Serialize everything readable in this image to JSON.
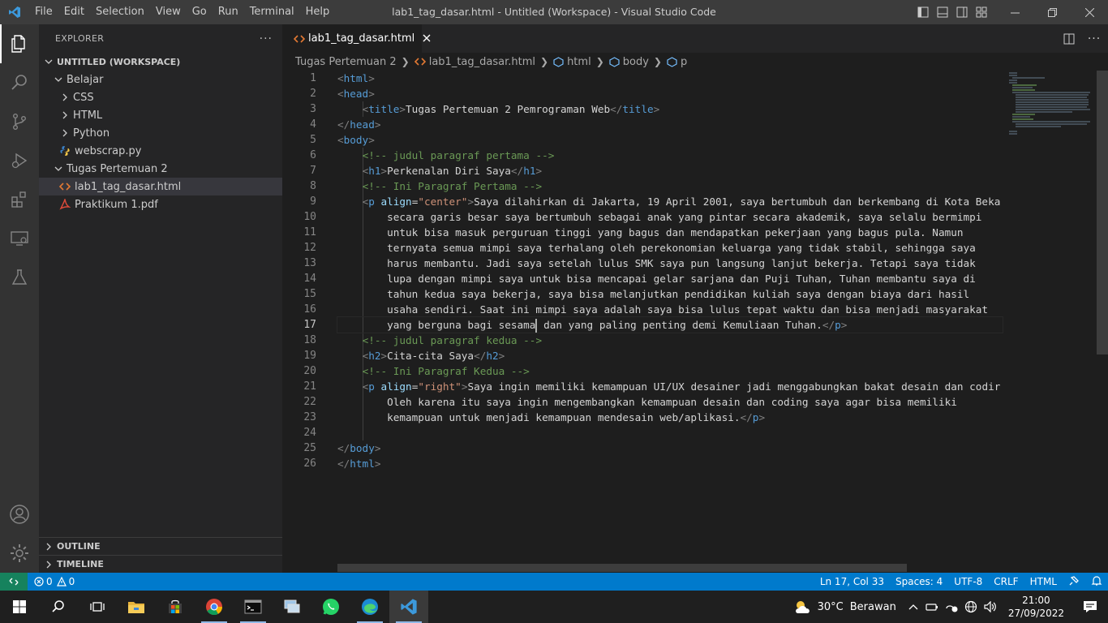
{
  "window": {
    "title": "lab1_tag_dasar.html - Untitled (Workspace) - Visual Studio Code",
    "menu": [
      "File",
      "Edit",
      "Selection",
      "View",
      "Go",
      "Run",
      "Terminal",
      "Help"
    ]
  },
  "sidebar": {
    "header": "EXPLORER",
    "more": "···",
    "workspace": "UNTITLED (WORKSPACE)",
    "tree": [
      {
        "label": "Belajar",
        "kind": "folder-open",
        "depth": 1
      },
      {
        "label": "CSS",
        "kind": "folder",
        "depth": 2
      },
      {
        "label": "HTML",
        "kind": "folder",
        "depth": 2
      },
      {
        "label": "Python",
        "kind": "folder",
        "depth": 2
      },
      {
        "label": "webscrap.py",
        "kind": "python-file",
        "depth": 2
      },
      {
        "label": "Tugas Pertemuan 2",
        "kind": "folder-open",
        "depth": 1
      },
      {
        "label": "lab1_tag_dasar.html",
        "kind": "html-file",
        "depth": 2,
        "selected": true
      },
      {
        "label": "Praktikum 1.pdf",
        "kind": "pdf-file",
        "depth": 2
      }
    ],
    "outline": "OUTLINE",
    "timeline": "TIMELINE"
  },
  "editor": {
    "tab": "lab1_tag_dasar.html",
    "breadcrumbs": [
      "Tugas Pertemuan 2",
      "lab1_tag_dasar.html",
      "html",
      "body",
      "p"
    ],
    "current_line": 17,
    "lines": [
      "1",
      "2",
      "3",
      "4",
      "5",
      "6",
      "7",
      "8",
      "9",
      "10",
      "11",
      "12",
      "13",
      "14",
      "15",
      "16",
      "17",
      "18",
      "19",
      "20",
      "21",
      "22",
      "23",
      "24",
      "25",
      "26"
    ],
    "code": {
      "l3_title": "Tugas Pertemuan 2 Pemrograman Web",
      "l6": "<!-- judul paragraf pertama -->",
      "l7_h1": "Perkenalan Diri Saya",
      "l8": "<!-- Ini Paragraf Pertama -->",
      "l9_attr_val": "\"center\"",
      "l9_text": "Saya dilahirkan di Jakarta, 19 April 2001, saya bertumbuh dan berkembang di Kota Beka",
      "l10": "secara garis besar saya bertumbuh sebagai anak yang pintar secara akademik, saya selalu bermimpi",
      "l11": "untuk bisa masuk perguruan tinggi yang bagus dan mendapatkan pekerjaan yang bagus pula. Namun",
      "l12": "ternyata semua mimpi saya terhalang oleh perekonomian keluarga yang tidak stabil, sehingga saya",
      "l13": "harus membantu. Jadi saya setelah lulus SMK saya pun langsung lanjut bekerja. Tetapi saya tidak",
      "l14": "lupa dengan mimpi saya untuk bisa mencapai gelar sarjana dan Puji Tuhan, Tuhan membantu saya di",
      "l15": "tahun kedua saya bekerja, saya bisa melanjutkan pendidikan kuliah saya dengan biaya dari hasil",
      "l16": "usaha sendiri. Saat ini mimpi saya adalah saya bisa lulus tepat waktu dan bisa menjadi masyarakat",
      "l17a": "yang berguna bagi sesama",
      "l17b": " dan yang paling penting demi Kemuliaan Tuhan.",
      "l18": "<!-- judul paragraf kedua -->",
      "l19_h2": "Cita-cita Saya",
      "l20": "<!-- Ini Paragraf Kedua -->",
      "l21_attr_val": "\"right\"",
      "l21_text": "Saya ingin memiliki kemampuan UI/UX desainer jadi menggabungkan bakat desain dan codir",
      "l22": "Oleh karena itu saya ingin mengembangkan kemampuan desain dan coding saya agar bisa memiliki",
      "l23": "kemampuan untuk menjadi kemampuan mendesain web/aplikasi."
    }
  },
  "statusbar": {
    "errors": "0",
    "warnings": "0",
    "position": "Ln 17, Col 33",
    "spaces": "Spaces: 4",
    "encoding": "UTF-8",
    "eol": "CRLF",
    "language": "HTML"
  },
  "taskbar": {
    "weather_temp": "30°C",
    "weather_desc": "Berawan",
    "time": "21:00",
    "date": "27/09/2022"
  },
  "colors": {
    "accent": "#007acc",
    "titlebar": "#3c3c3c",
    "sidebar": "#252526",
    "editor": "#1e1e1e"
  }
}
